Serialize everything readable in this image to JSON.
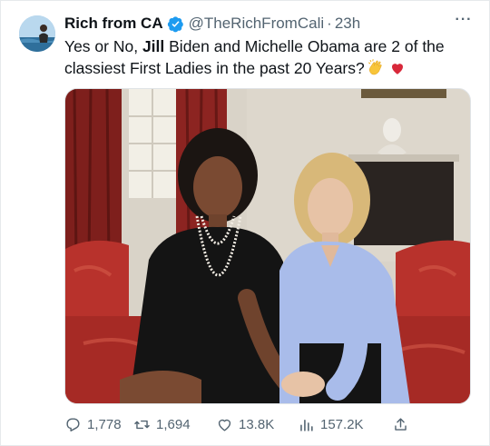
{
  "tweet": {
    "display_name": "Rich from CA",
    "handle": "@TheRichFromCali",
    "separator": "·",
    "time": "23h",
    "more_label": "···",
    "text_before": "Yes or No, ",
    "text_bold": "Jill",
    "text_after": " Biden and Michelle Obama are 2 of the classiest First Ladies in the past 20 Years?",
    "emojis": [
      "clapping-hands",
      "red-heart"
    ],
    "verified": true
  },
  "actions": {
    "replies": "1,778",
    "retweets": "1,694",
    "likes": "13.8K",
    "views": "157.2K"
  },
  "colors": {
    "verified_blue": "#1d9bf0",
    "muted_text": "#536471",
    "primary_text": "#0f1419"
  },
  "icons": [
    "verified-badge-icon",
    "more-icon",
    "reply-icon",
    "retweet-icon",
    "like-icon",
    "views-icon",
    "share-icon"
  ]
}
